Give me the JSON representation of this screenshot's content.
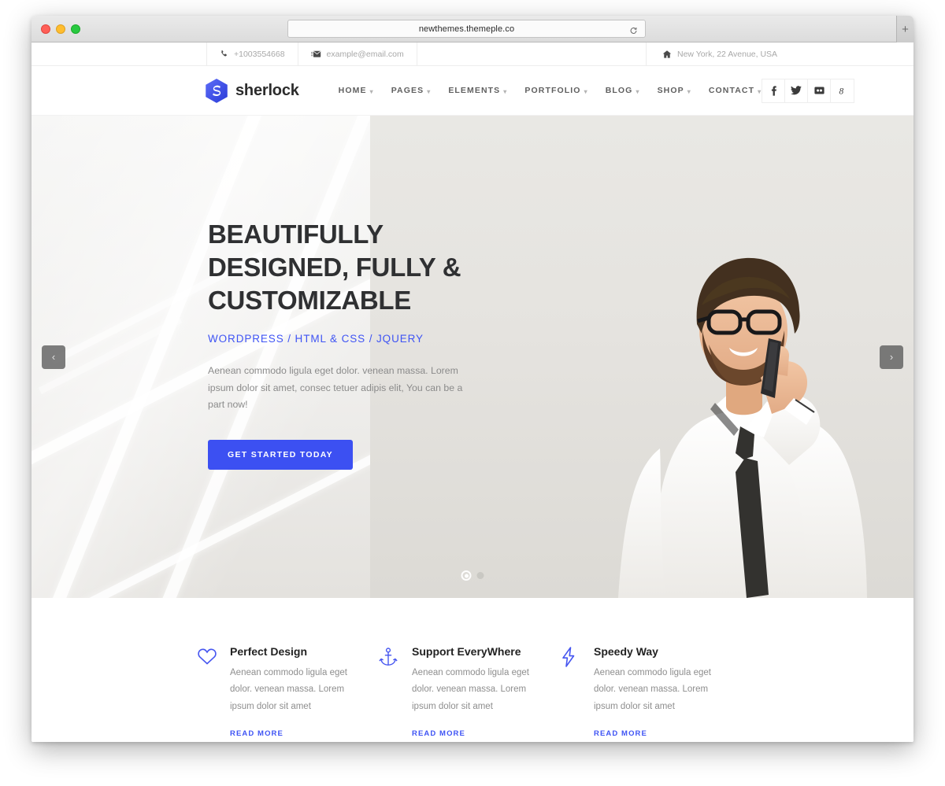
{
  "browser": {
    "url": "newthemes.themeple.co",
    "reload_icon": "reload-icon",
    "new_tab_label": "+"
  },
  "topbar": {
    "phone": "+1003554668",
    "email": "example@email.com",
    "address": "New York, 22 Avenue, USA",
    "phone_icon": "phone-icon",
    "email_icon": "envelope-icon",
    "address_icon": "home-icon"
  },
  "header": {
    "logo_text": "sherlock",
    "nav": [
      {
        "label": "HOME",
        "has_caret": true
      },
      {
        "label": "PAGES",
        "has_caret": true
      },
      {
        "label": "ELEMENTS",
        "has_caret": true
      },
      {
        "label": "PORTFOLIO",
        "has_caret": true
      },
      {
        "label": "BLOG",
        "has_caret": true
      },
      {
        "label": "SHOP",
        "has_caret": true
      },
      {
        "label": "CONTACT",
        "has_caret": true
      }
    ],
    "socials": [
      {
        "name": "facebook",
        "glyph": "f"
      },
      {
        "name": "twitter",
        "glyph": "t"
      },
      {
        "name": "flickr",
        "glyph": "fl"
      },
      {
        "name": "google-plus",
        "glyph": "g"
      }
    ]
  },
  "hero": {
    "title_line1": "BEAUTIFULLY",
    "title_line2": "DESIGNED, FULLY &",
    "title_line3": "CUSTOMIZABLE",
    "subtitle": "WORDPRESS / HTML & CSS / JQUERY",
    "paragraph": "Aenean commodo ligula eget dolor. venean massa. Lorem ipsum dolor sit amet, consec tetuer adipis elit, You can be a part now!",
    "cta_label": "GET STARTED TODAY",
    "prev_label": "‹",
    "next_label": "›",
    "slide_count": 2,
    "active_slide": 1,
    "accent_color": "#3c50f2",
    "link_color": "#3f54f4"
  },
  "features": [
    {
      "icon": "heart-icon",
      "title": "Perfect Design",
      "text": "Aenean commodo ligula eget dolor. venean massa. Lorem ipsum dolor sit amet",
      "link": "READ MORE"
    },
    {
      "icon": "anchor-icon",
      "title": "Support EveryWhere",
      "text": "Aenean commodo ligula eget dolor. venean massa. Lorem ipsum dolor sit amet",
      "link": "READ MORE"
    },
    {
      "icon": "bolt-icon",
      "title": "Speedy Way",
      "text": "Aenean commodo ligula eget dolor. venean massa. Lorem ipsum dolor sit amet",
      "link": "READ MORE"
    }
  ]
}
